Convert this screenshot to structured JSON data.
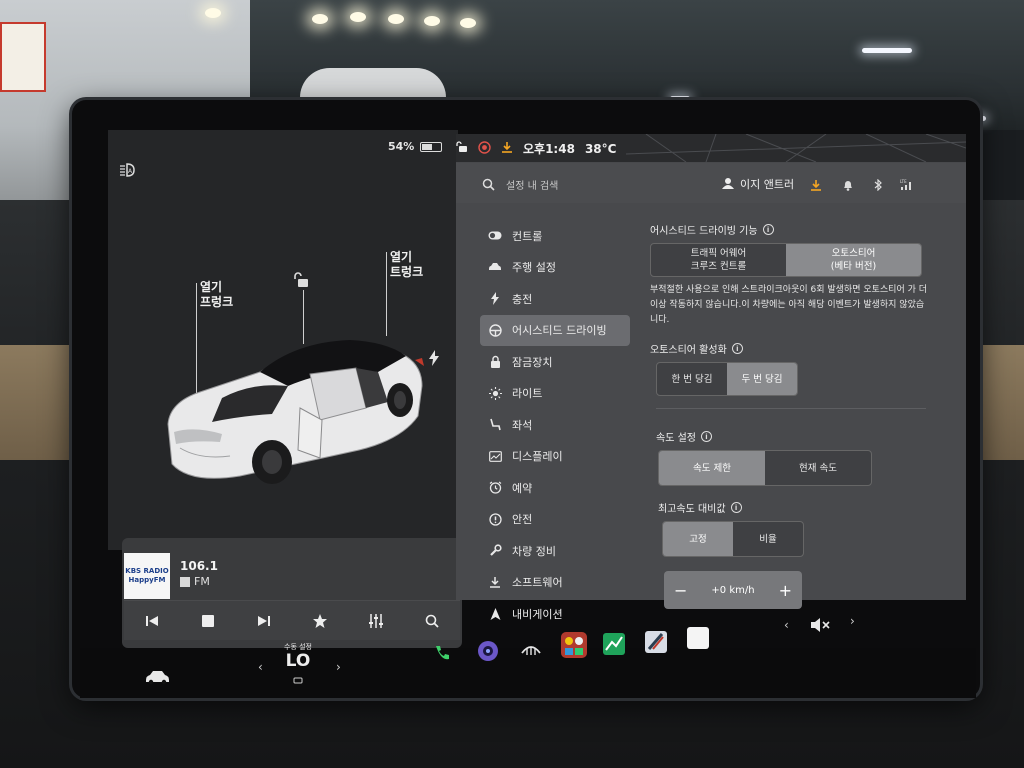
{
  "vehicle": {
    "battery_percent": "54%",
    "battery_level": 0.54,
    "trunk_front_label": "열기\n프렁크",
    "trunk_rear_label": "열기\n트렁크"
  },
  "media": {
    "station_art": "KBS RADIO\nHappyFM",
    "frequency": "106.1",
    "band": "FM",
    "controls": [
      "previous-icon",
      "stop-icon",
      "next-icon",
      "favorite-icon",
      "equalizer-icon",
      "search-icon"
    ]
  },
  "status_bar": {
    "time": "오후1:48",
    "temperature": "38°C"
  },
  "header": {
    "search_placeholder": "설정 내 검색",
    "profile_name": "이지 앤트러"
  },
  "sidebar": {
    "items": [
      {
        "label": "컨트롤",
        "icon": "toggle-icon"
      },
      {
        "label": "주행 설정",
        "icon": "car-icon"
      },
      {
        "label": "충전",
        "icon": "bolt-icon"
      },
      {
        "label": "어시스티드 드라이빙",
        "icon": "steering-wheel-icon",
        "active": true
      },
      {
        "label": "잠금장치",
        "icon": "lock-icon"
      },
      {
        "label": "라이트",
        "icon": "light-icon"
      },
      {
        "label": "좌석",
        "icon": "seat-icon"
      },
      {
        "label": "디스플레이",
        "icon": "display-icon"
      },
      {
        "label": "예약",
        "icon": "alarm-icon"
      },
      {
        "label": "안전",
        "icon": "safety-icon"
      },
      {
        "label": "차량 정비",
        "icon": "wrench-icon"
      },
      {
        "label": "소프트웨어",
        "icon": "download-icon"
      },
      {
        "label": "내비게이션",
        "icon": "navigation-icon"
      }
    ]
  },
  "assisted_driving": {
    "features_title": "어시스티드 드라이빙 기능",
    "feature_options": [
      "트래픽 어웨어\n크루즈 컨트롤",
      "오토스티어\n(베타 버전)"
    ],
    "feature_selected": 1,
    "warning": "부적절한 사용으로 인해 스트라이크아웃이 6회 발생하면 오토스티어 가 더 이상 작동하지 않습니다.이 차량에는 아직 해당 이벤트가 발생하지 않았습니다.",
    "activation_title": "오토스티어 활성화",
    "activation_options": [
      "한 번 당김",
      "두 번 당김"
    ],
    "activation_selected": 1,
    "speed_title": "속도 설정",
    "speed_options": [
      "속도 제한",
      "현재 속도"
    ],
    "speed_selected": 0,
    "offset_title": "최고속도 대비값",
    "offset_options": [
      "고정",
      "비율"
    ],
    "offset_selected": 0,
    "offset_value": "+0 km/h",
    "minus": "−",
    "plus": "+"
  },
  "dock": {
    "car_icon": "car-icon",
    "climate_caption": "수동 설정",
    "climate_value": "LO",
    "apps": [
      "phone-icon",
      "camera-icon",
      "defrost-icon",
      "games-icon",
      "charts-icon",
      "browser-icon",
      "notes-icon"
    ],
    "volume_icon": "mute-icon"
  },
  "colors": {
    "accent_download": "#f5a623",
    "phone_green": "#3ecf6a",
    "active_item": "#6b6c70"
  }
}
